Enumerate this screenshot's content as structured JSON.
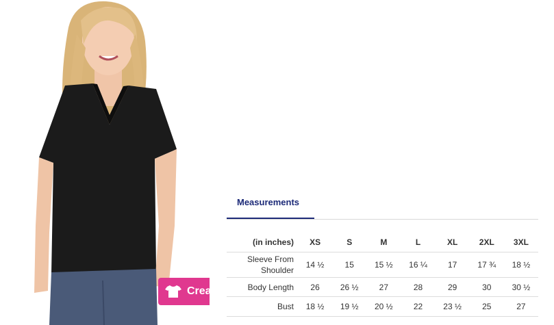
{
  "create_button": {
    "label": "Create",
    "icon": "shirt-icon"
  },
  "tabs": [
    {
      "label": "Measurements"
    }
  ],
  "size_chart": {
    "header": [
      "(in inches)",
      "XS",
      "S",
      "M",
      "L",
      "XL",
      "2XL",
      "3XL"
    ],
    "rows": [
      {
        "label": "Sleeve From Shoulder",
        "values": [
          "14 ½",
          "15",
          "15 ½",
          "16 ¼",
          "17",
          "17 ¾",
          "18 ½"
        ]
      },
      {
        "label": "Body Length",
        "values": [
          "26",
          "26 ½",
          "27",
          "28",
          "29",
          "30",
          "30 ½"
        ]
      },
      {
        "label": "Bust",
        "values": [
          "18 ½",
          "19 ½",
          "20 ½",
          "22",
          "23 ½",
          "25",
          "27"
        ]
      }
    ]
  },
  "colors": {
    "accent": "#1c2a78",
    "button": "#e0388f",
    "shirt": "#1b1b1b",
    "jeans": "#4a5a78"
  }
}
